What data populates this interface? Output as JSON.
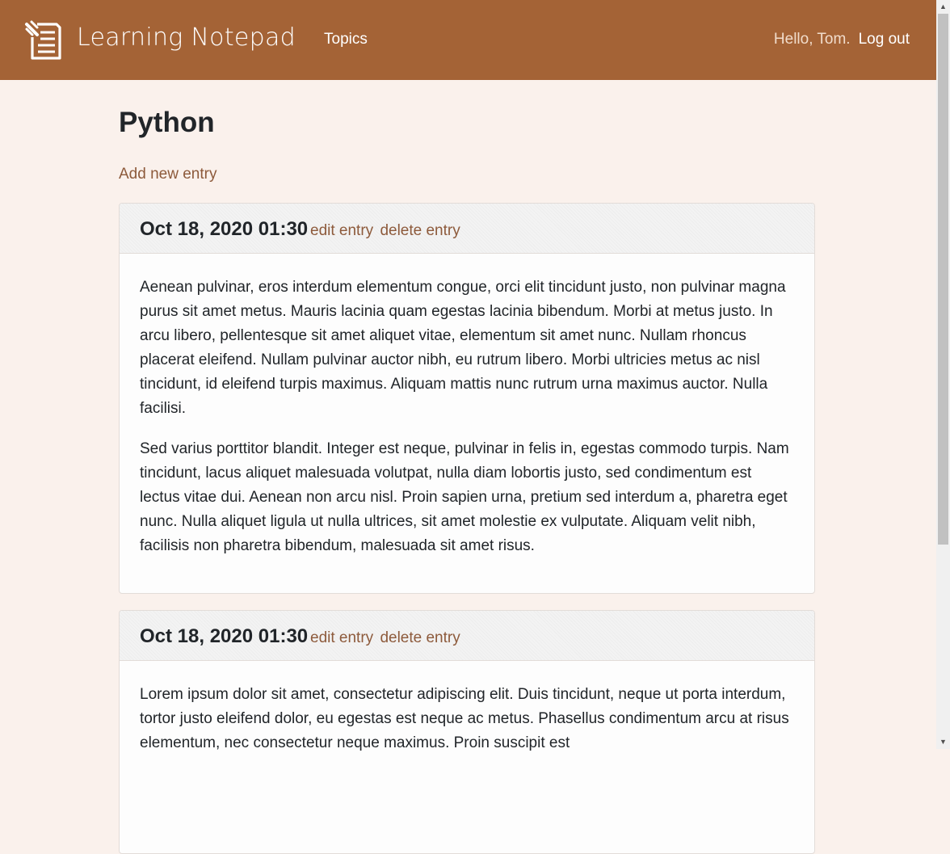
{
  "navbar": {
    "brand": "Learning Notepad",
    "logo_icon": "notepad-icon",
    "topics_label": "Topics",
    "greeting": "Hello, Tom.",
    "logout_label": "Log out"
  },
  "page": {
    "title": "Python",
    "add_entry_label": "Add new entry"
  },
  "entries": [
    {
      "date": "Oct 18, 2020 01:30",
      "edit_label": "edit entry",
      "delete_label": "delete entry",
      "paragraphs": [
        "Aenean pulvinar, eros interdum elementum congue, orci elit tincidunt justo, non pulvinar magna purus sit amet metus. Mauris lacinia quam egestas lacinia bibendum. Morbi at metus justo. In arcu libero, pellentesque sit amet aliquet vitae, elementum sit amet nunc. Nullam rhoncus placerat eleifend. Nullam pulvinar auctor nibh, eu rutrum libero. Morbi ultricies metus ac nisl tincidunt, id eleifend turpis maximus. Aliquam mattis nunc rutrum urna maximus auctor. Nulla facilisi.",
        "Sed varius porttitor blandit. Integer est neque, pulvinar in felis in, egestas commodo turpis. Nam tincidunt, lacus aliquet malesuada volutpat, nulla diam lobortis justo, sed condimentum est lectus vitae dui. Aenean non arcu nisl. Proin sapien urna, pretium sed interdum a, pharetra eget nunc. Nulla aliquet ligula ut nulla ultrices, sit amet molestie ex vulputate. Aliquam velit nibh, facilisis non pharetra bibendum, malesuada sit amet risus."
      ]
    },
    {
      "date": "Oct 18, 2020 01:30",
      "edit_label": "edit entry",
      "delete_label": "delete entry",
      "paragraphs": [
        "Lorem ipsum dolor sit amet, consectetur adipiscing elit. Duis tincidunt, neque ut porta interdum, tortor justo eleifend dolor, eu egestas est neque ac metus. Phasellus condimentum arcu at risus elementum, nec consectetur neque maximus. Proin suscipit est"
      ]
    }
  ],
  "colors": {
    "navbar_bg": "#a46336",
    "page_bg": "#faf1ec",
    "link": "#8d5a3b"
  },
  "scrollbar": {
    "up_icon": "scroll-up-arrow-icon",
    "down_icon": "scroll-down-arrow-icon"
  }
}
